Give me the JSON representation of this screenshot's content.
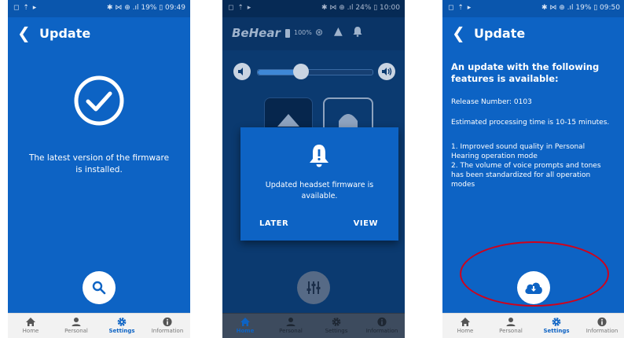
{
  "screen1": {
    "status": {
      "icons_left": "◻ ⇡ ▸",
      "right": "✱ ⋈ ⊕ .ıl 19% ▯ 09:49"
    },
    "header": {
      "back_icon": "chevron-left-icon",
      "title": "Update"
    },
    "message": "The latest version of the firmware is installed.",
    "fab_icon": "search-icon"
  },
  "screen2": {
    "status": {
      "icons_left": "◻ ⇡ ▸",
      "right": "✱ ⋈ ⊕ .ıl 24% ▯ 10:00"
    },
    "header": {
      "brand": "BeHear",
      "battery": "100%"
    },
    "volume": {
      "level": 0.38
    },
    "dialog": {
      "icon": "bell-alert-icon",
      "message": "Updated headset firmware is available.",
      "later_label": "LATER",
      "view_label": "VIEW"
    },
    "fab_icon": "equalizer-icon"
  },
  "screen3": {
    "status": {
      "icons_left": "◻ ⇡ ▸",
      "right": "✱ ⋈ ⊕ .ıl 19% ▯ 09:50"
    },
    "header": {
      "back_icon": "chevron-left-icon",
      "title": "Update"
    },
    "heading": "An update with the following features is available:",
    "release": "Release Number: 0103",
    "estimate": "Estimated processing time is 10-15 minutes.",
    "features": [
      "1. Improved sound quality in Personal Hearing operation mode",
      "2. The volume of voice prompts and tones has been standardized for all operation modes"
    ],
    "fab_icon": "cloud-download-icon",
    "highlight_color": "#d0021b"
  },
  "nav": {
    "items": [
      {
        "label": "Home",
        "icon": "home-icon"
      },
      {
        "label": "Personal",
        "icon": "person-icon"
      },
      {
        "label": "Settings",
        "icon": "gear-icon"
      },
      {
        "label": "Information",
        "icon": "info-icon"
      }
    ]
  },
  "colors": {
    "primary": "#0d63c4",
    "dark": "#0a3f7c",
    "dim_overlay": "#062a55",
    "nav_bg": "#f2f2f2"
  }
}
